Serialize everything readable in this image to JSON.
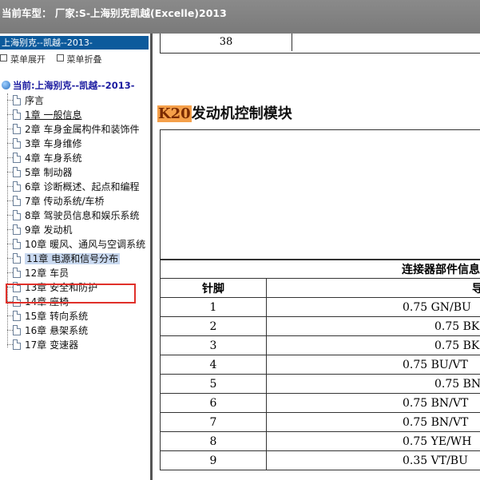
{
  "window": {
    "title": "当前车型： 厂家:S-上海别克凯越(Excelle)2013"
  },
  "sidebar": {
    "header": "上海别克--凯越--2013-",
    "expand_menu": "菜单展开",
    "collapse_menu": "菜单折叠",
    "root": "当前:上海别克--凯越--2013-",
    "items": [
      {
        "label": "序言"
      },
      {
        "label": "1章 一般信息"
      },
      {
        "label": "2章 车身金属构件和装饰件"
      },
      {
        "label": "3章 车身维修"
      },
      {
        "label": "4章 车身系统"
      },
      {
        "label": "5章 制动器"
      },
      {
        "label": "6章 诊断概述、起点和编程"
      },
      {
        "label": "7章 传动系统/车桥"
      },
      {
        "label": "8章 驾驶员信息和娱乐系统"
      },
      {
        "label": "9章 发动机"
      },
      {
        "label": "10章 暖风、通风与空调系统"
      },
      {
        "label": "11章 电源和信号分布"
      },
      {
        "label": "12章 车员"
      },
      {
        "label": "13章 安全和防护"
      },
      {
        "label": "14章 座椅"
      },
      {
        "label": "15章 转向系统"
      },
      {
        "label": "16章 悬架系统"
      },
      {
        "label": "17章 变速器"
      }
    ]
  },
  "content": {
    "top_cell": "38",
    "heading_code": "K20",
    "heading_text": "发动机控制模块",
    "table": {
      "caption": "连接器部件信息",
      "col_pin": "针脚",
      "col_wire": "导线",
      "rows": [
        {
          "pin": "1",
          "wire": "0.75 GN/BU"
        },
        {
          "pin": "2",
          "wire": "0.75 BK"
        },
        {
          "pin": "3",
          "wire": "0.75 BK"
        },
        {
          "pin": "4",
          "wire": "0.75 BU/VT"
        },
        {
          "pin": "5",
          "wire": "0.75 BN"
        },
        {
          "pin": "6",
          "wire": "0.75 BN/VT"
        },
        {
          "pin": "7",
          "wire": "0.75 BN/VT"
        },
        {
          "pin": "8",
          "wire": "0.75 YE/WH"
        },
        {
          "pin": "9",
          "wire": "0.35 VT/BU"
        }
      ]
    }
  },
  "colors": {
    "titlebar": "#808080",
    "sidebar_header": "#0c5a9c",
    "selection_outline": "#e0302a",
    "code_highlight": "#f5a04a"
  }
}
